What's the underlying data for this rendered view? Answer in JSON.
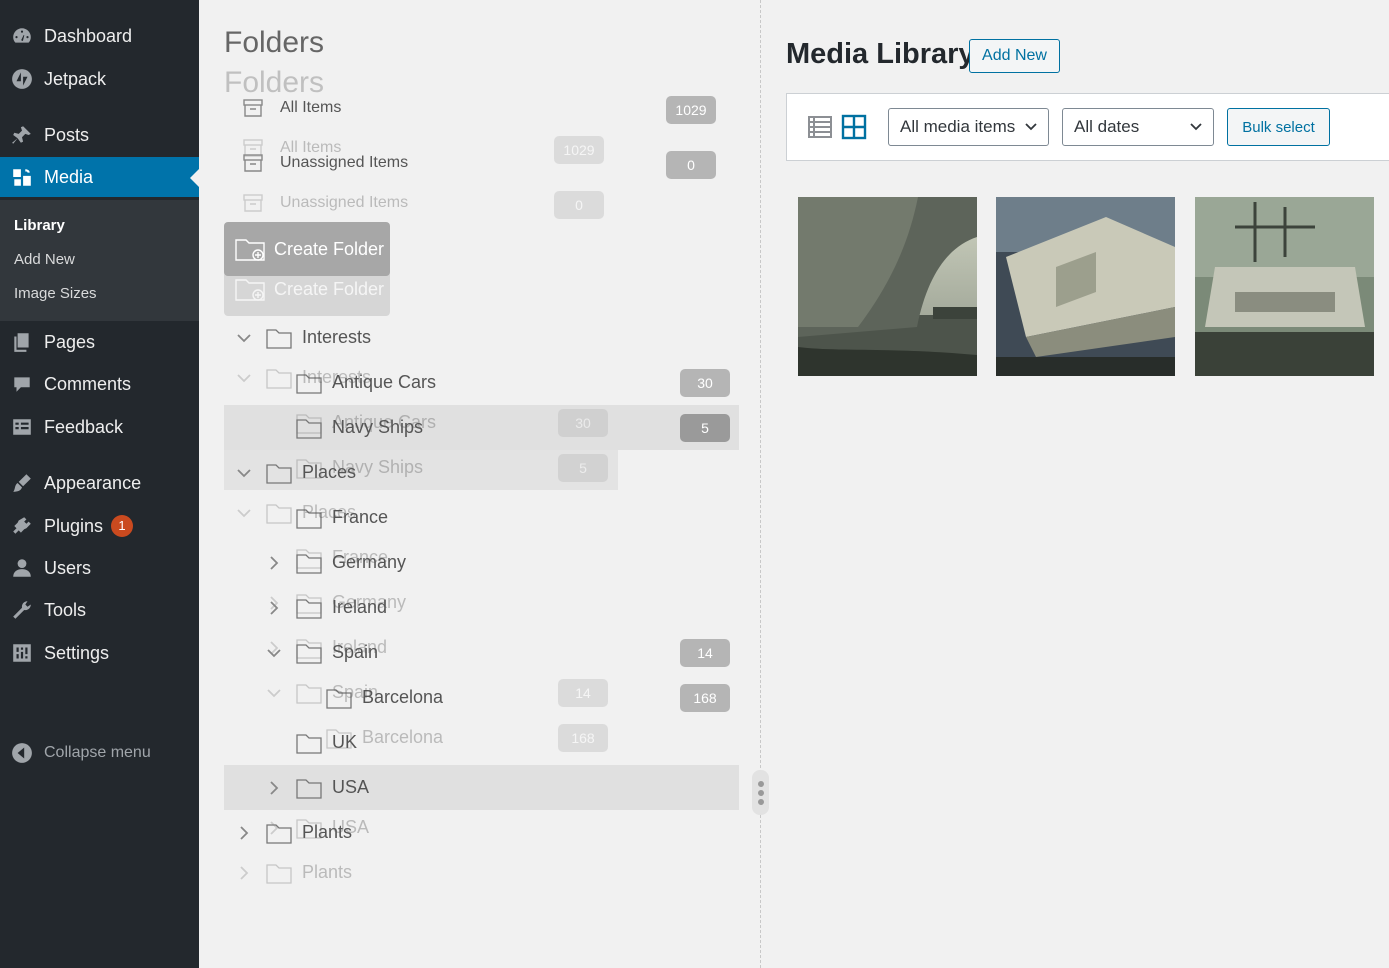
{
  "sidebar": {
    "items": [
      {
        "label": "Dashboard",
        "icon": "dashboard-icon"
      },
      {
        "label": "Jetpack",
        "icon": "jetpack-icon"
      },
      {
        "label": "Posts",
        "icon": "pin-icon"
      },
      {
        "label": "Media",
        "icon": "media-icon"
      },
      {
        "label": "Pages",
        "icon": "pages-icon"
      },
      {
        "label": "Comments",
        "icon": "comment-icon"
      },
      {
        "label": "Feedback",
        "icon": "feedback-icon"
      },
      {
        "label": "Appearance",
        "icon": "brush-icon"
      },
      {
        "label": "Plugins",
        "icon": "plug-icon",
        "badge": "1"
      },
      {
        "label": "Users",
        "icon": "user-icon"
      },
      {
        "label": "Tools",
        "icon": "wrench-icon"
      },
      {
        "label": "Settings",
        "icon": "settings-icon"
      }
    ],
    "submenu": [
      "Library",
      "Add New",
      "Image Sizes"
    ],
    "collapse_label": "Collapse menu"
  },
  "folders": {
    "title": "Folders",
    "all_items": {
      "label": "All Items",
      "count": "1029"
    },
    "unassigned": {
      "label": "Unassigned Items",
      "count": "0"
    },
    "create_label": "Create Folder",
    "tree": [
      {
        "label": "Interests"
      },
      {
        "label": "Antique Cars",
        "count": "30"
      },
      {
        "label": "Navy Ships",
        "count": "5"
      },
      {
        "label": "Places"
      },
      {
        "label": "France"
      },
      {
        "label": "Germany"
      },
      {
        "label": "Ireland"
      },
      {
        "label": "Spain",
        "count": "14"
      },
      {
        "label": "Barcelona",
        "count": "168"
      },
      {
        "label": "UK"
      },
      {
        "label": "USA"
      },
      {
        "label": "Plants"
      }
    ]
  },
  "media": {
    "title": "Media Library",
    "add_new": "Add New",
    "filter_type": "All media items",
    "filter_date": "All dates",
    "bulk_select": "Bulk select",
    "accent": "#0071a1"
  }
}
